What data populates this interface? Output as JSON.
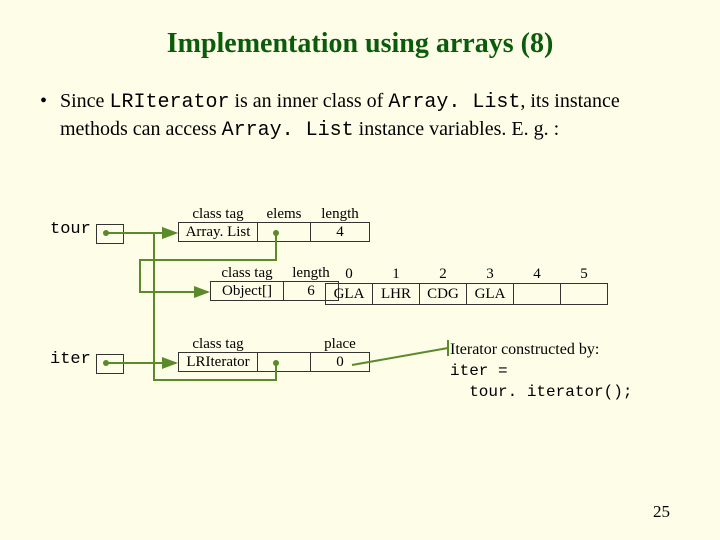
{
  "title": "Implementation using arrays (8)",
  "bullet": {
    "lead": "Since ",
    "code1": "LRIterator",
    "mid1": " is an inner class of ",
    "code2": "Array. List",
    "mid2": ", its instance methods can access ",
    "code3": "Array. List",
    "mid3": " instance variables. E. g. :"
  },
  "outer": {
    "tour": "tour",
    "iter": "iter"
  },
  "arraylist": {
    "hdr_classtag": "class tag",
    "hdr_elems": "elems",
    "hdr_length": "length",
    "classtag": "Array. List",
    "length": "4"
  },
  "objarr": {
    "hdr_classtag": "class tag",
    "hdr_length": "length",
    "classtag": "Object[]",
    "length": "6",
    "idx": [
      "0",
      "1",
      "2",
      "3",
      "4",
      "5"
    ],
    "vals": [
      "GLA",
      "LHR",
      "CDG",
      "GLA",
      "",
      ""
    ]
  },
  "iterobj": {
    "hdr_classtag": "class tag",
    "hdr_place": "place",
    "classtag": "LRIterator",
    "place": "0"
  },
  "note": {
    "line1": "Iterator constructed by:",
    "line2": "iter =",
    "line3": "  tour. iterator();"
  },
  "slidenum": "25"
}
